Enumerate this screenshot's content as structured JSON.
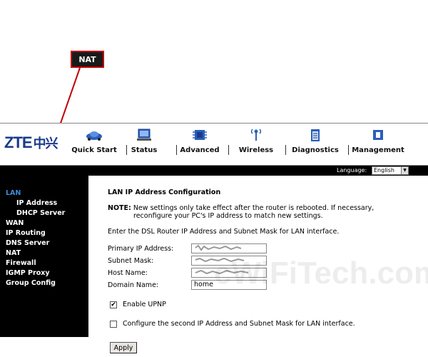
{
  "callout": {
    "label": "NAT"
  },
  "header": {
    "logo": {
      "latin": "ZTE",
      "chinese": "中兴"
    },
    "nav": [
      {
        "label": "Quick Start",
        "icon": "car-icon"
      },
      {
        "label": "Status",
        "icon": "monitor-icon"
      },
      {
        "label": "Advanced",
        "icon": "chip-icon"
      },
      {
        "label": "Wireless",
        "icon": "antenna-icon"
      },
      {
        "label": "Diagnostics",
        "icon": "clipboard-icon"
      },
      {
        "label": "Management",
        "icon": "box-icon"
      }
    ]
  },
  "langbar": {
    "label": "Language:",
    "selected": "English"
  },
  "sidebar": {
    "items": [
      {
        "label": "LAN",
        "active": true
      },
      {
        "label": "IP Address",
        "sub": true
      },
      {
        "label": "DHCP Server",
        "sub": true
      },
      {
        "label": "WAN"
      },
      {
        "label": "IP Routing"
      },
      {
        "label": "DNS Server"
      },
      {
        "label": "NAT"
      },
      {
        "label": "Firewall"
      },
      {
        "label": "IGMP Proxy"
      },
      {
        "label": "Group Config"
      }
    ]
  },
  "main": {
    "title": "LAN IP Address Configuration",
    "note_label": "NOTE:",
    "note_line1": "New settings only take effect after the router is rebooted. If necessary,",
    "note_line2": "reconfigure your PC's IP address to match new settings.",
    "instruction": "Enter the DSL Router IP Address and Subnet Mask for LAN interface.",
    "fields": [
      {
        "label": "Primary IP Address:",
        "value": ""
      },
      {
        "label": "Subnet Mask:",
        "value": ""
      },
      {
        "label": "Host Name:",
        "value": ""
      },
      {
        "label": "Domain Name:",
        "value": "home"
      }
    ],
    "enable_upnp": {
      "label": "Enable UPNP",
      "checked": true
    },
    "second_ip": {
      "label": "Configure the second IP Address and Subnet Mask for LAN interface.",
      "checked": false
    },
    "apply_label": "Apply"
  },
  "watermark": {
    "text": "cWiFiTech.com"
  },
  "colors": {
    "sidebar_bg": "#000000",
    "active_link": "#3d8bd8",
    "callout_border": "#c00000",
    "logo": "#1a3a8c"
  }
}
